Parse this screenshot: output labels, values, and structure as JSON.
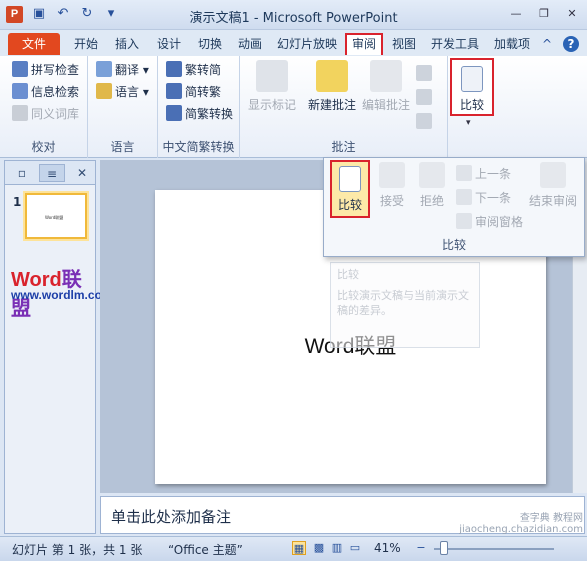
{
  "titlebar": {
    "app_icon": "P",
    "title": "演示文稿1 - Microsoft PowerPoint",
    "qat": [
      "save-icon",
      "undo-icon",
      "redo-icon",
      "customize-icon"
    ],
    "window_controls": [
      "minimize-icon",
      "restore-icon",
      "close-icon"
    ]
  },
  "tabs": {
    "file": "文件",
    "items": [
      "开始",
      "插入",
      "设计",
      "切换",
      "动画",
      "幻灯片放映",
      "审阅",
      "视图",
      "开发工具",
      "加载项"
    ],
    "active": "审阅"
  },
  "ribbon": {
    "proofing": {
      "label": "校对",
      "spelling": "拼写检查",
      "research": "信息检索",
      "thesaurus": "同义词库"
    },
    "language": {
      "label": "语言",
      "translate": "翻译",
      "language": "语言"
    },
    "chinese_conversion": {
      "label": "中文简繁转换",
      "to_simplified": "繁转简",
      "to_traditional": "简转繁",
      "convert": "简繁转换"
    },
    "comments": {
      "label": "批注",
      "show_markup": "显示标记",
      "new_comment": "新建批注",
      "edit_comment": "编辑批注"
    },
    "compare": {
      "label": "比较"
    }
  },
  "dropdown": {
    "label": "比较",
    "compare": "比较",
    "accept": "接受",
    "reject": "拒绝",
    "previous": "上一条",
    "next": "下一条",
    "reviewing_pane": "审阅窗格",
    "end_review": "结束审阅"
  },
  "tooltip_ghost": {
    "title": "比较",
    "body": "比较演示文稿与当前演示文稿的差异。"
  },
  "left_pane": {
    "slide_number": "1",
    "logo_word": "Word",
    "logo_cn": "联盟",
    "url": "www.wordlm.com"
  },
  "slide": {
    "text": "Word联盟"
  },
  "notes": {
    "placeholder": "单击此处添加备注"
  },
  "statusbar": {
    "slide_info": "幻灯片 第 1 张，共 1 张",
    "theme": "“Office 主题”",
    "zoom": "41%",
    "zoom_out": "−",
    "watermark_line1": "查字典 教程网",
    "watermark_line2": "jiaocheng.chazidian.com"
  },
  "colors": {
    "file_tab": "#e2481f",
    "highlight": "#d9232d",
    "accent": "#2a63b5"
  }
}
